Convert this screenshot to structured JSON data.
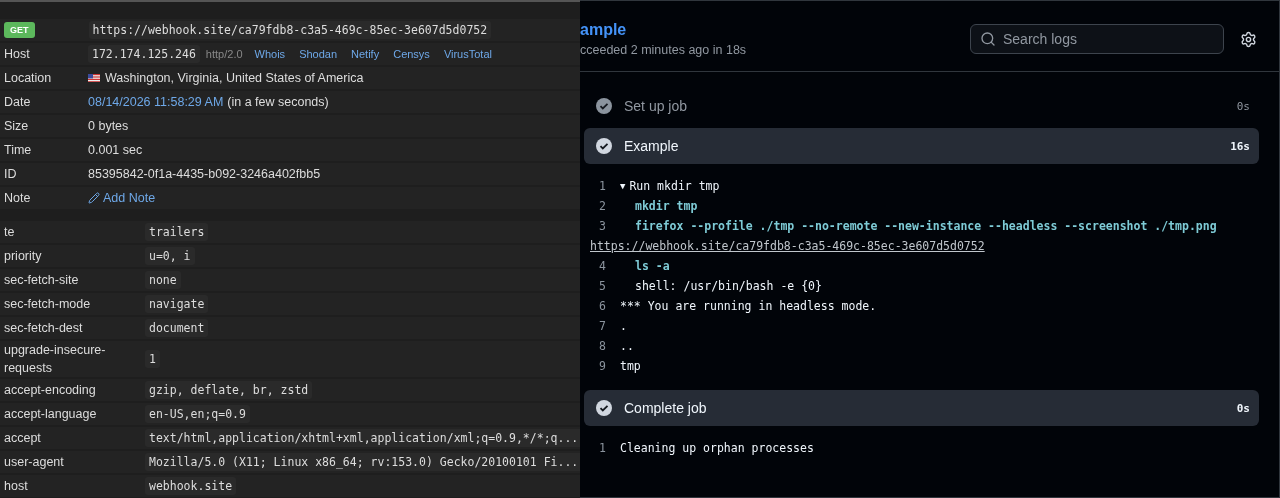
{
  "request": {
    "method": "GET",
    "url": "https://webhook.site/ca79fdb8-c3a5-469c-85ec-3e607d5d0752",
    "details": [
      {
        "label": "Host",
        "kind": "host",
        "value": "172.174.125.246",
        "protocol": "http/2.0",
        "links": [
          "Whois",
          "Shodan",
          "Netify",
          "Censys",
          "VirusTotal"
        ]
      },
      {
        "label": "Location",
        "kind": "location",
        "value": "Washington, Virginia, United States of America"
      },
      {
        "label": "Date",
        "kind": "date",
        "value": "08/14/2026 11:58:29 AM",
        "note": "(in a few seconds)"
      },
      {
        "label": "Size",
        "kind": "text",
        "value": "0 bytes"
      },
      {
        "label": "Time",
        "kind": "text",
        "value": "0.001 sec"
      },
      {
        "label": "ID",
        "kind": "text",
        "value": "85395842-0f1a-4435-b092-3246a402fbb5"
      },
      {
        "label": "Note",
        "kind": "note",
        "value": "Add Note"
      }
    ],
    "headers": [
      {
        "name": "te",
        "value": "trailers"
      },
      {
        "name": "priority",
        "value": "u=0, i"
      },
      {
        "name": "sec-fetch-site",
        "value": "none"
      },
      {
        "name": "sec-fetch-mode",
        "value": "navigate"
      },
      {
        "name": "sec-fetch-dest",
        "value": "document"
      },
      {
        "name": "upgrade-insecure-requests",
        "value": "1"
      },
      {
        "name": "accept-encoding",
        "value": "gzip, deflate, br, zstd"
      },
      {
        "name": "accept-language",
        "value": "en-US,en;q=0.9"
      },
      {
        "name": "accept",
        "value": "text/html,application/xhtml+xml,application/xml;q=0.9,*/*;q..."
      },
      {
        "name": "user-agent",
        "value": "Mozilla/5.0 (X11; Linux x86_64; rv:153.0) Gecko/20100101 Fi..."
      },
      {
        "name": "host",
        "value": "webhook.site"
      }
    ]
  },
  "job": {
    "title": "ample",
    "subtitle": "cceeded 2 minutes ago in 18s",
    "search": {
      "placeholder": "Search logs"
    },
    "steps": [
      {
        "name": "Set up job",
        "duration": "0s",
        "expanded": false
      },
      {
        "name": "Example",
        "duration": "16s",
        "expanded": true,
        "lines": [
          {
            "number": "1",
            "kind": "plain",
            "toggle": "▼",
            "text": "Run mkdir tmp"
          },
          {
            "number": "2",
            "kind": "command",
            "text": "mkdir tmp"
          },
          {
            "number": "3",
            "kind": "command",
            "text": "firefox --profile ./tmp --no-remote --new-instance --headless --screenshot ./tmp.png"
          },
          {
            "kind": "link",
            "text": "https://webhook.site/ca79fdb8-c3a5-469c-85ec-3e607d5d0752"
          },
          {
            "number": "4",
            "kind": "command",
            "text": "ls -a"
          },
          {
            "number": "5",
            "kind": "indented",
            "text": "shell: /usr/bin/bash -e {0}"
          },
          {
            "number": "6",
            "kind": "plain",
            "text": "*** You are running in headless mode."
          },
          {
            "number": "7",
            "kind": "plain",
            "text": "."
          },
          {
            "number": "8",
            "kind": "plain",
            "text": ".."
          },
          {
            "number": "9",
            "kind": "plain",
            "text": "tmp"
          }
        ]
      },
      {
        "name": "Complete job",
        "duration": "0s",
        "expanded": true,
        "lines": [
          {
            "number": "1",
            "kind": "plain",
            "text": "Cleaning up orphan processes"
          }
        ]
      }
    ]
  }
}
